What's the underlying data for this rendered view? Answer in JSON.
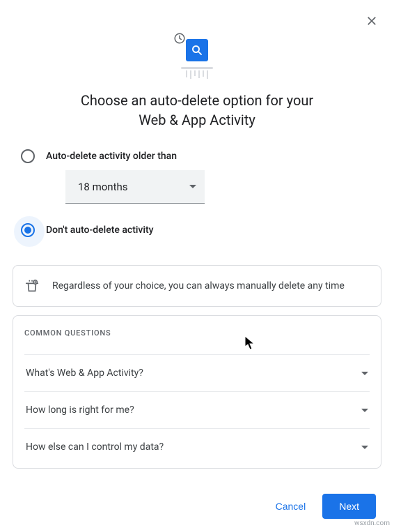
{
  "header": {
    "title_line1": "Choose an auto-delete option for your",
    "title_line2": "Web & App Activity"
  },
  "options": {
    "opt1_label": "Auto-delete activity older than",
    "opt1_selected": false,
    "dropdown_value": "18 months",
    "opt2_label": "Don't auto-delete activity",
    "opt2_selected": true
  },
  "info": {
    "text": "Regardless of your choice, you can always manually delete any time"
  },
  "common_questions": {
    "title": "COMMON QUESTIONS",
    "items": [
      "What's Web & App Activity?",
      "How long is right for me?",
      "How else can I control my data?"
    ]
  },
  "footer": {
    "cancel": "Cancel",
    "next": "Next"
  },
  "watermark": "wsxdn.com"
}
